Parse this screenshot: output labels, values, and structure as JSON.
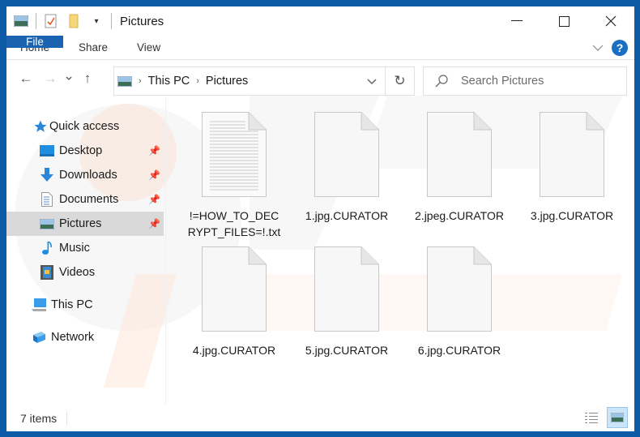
{
  "window": {
    "title": "Pictures",
    "controls": {
      "minimize": "—",
      "maximize": "☐",
      "close": "✕"
    }
  },
  "ribbon": {
    "tabs": [
      {
        "label": "File"
      },
      {
        "label": "Home"
      },
      {
        "label": "Share"
      },
      {
        "label": "View"
      }
    ],
    "help_label": "?"
  },
  "navigation": {
    "back": "←",
    "forward": "→",
    "recent": "⌄",
    "up": "↑",
    "breadcrumb": [
      "This PC",
      "Pictures"
    ],
    "refresh": "↻",
    "search_placeholder": "Search Pictures"
  },
  "sidebar": {
    "items": [
      {
        "label": "Quick access",
        "icon": "star-icon",
        "pinned": false
      },
      {
        "label": "Desktop",
        "icon": "desktop-icon",
        "pinned": true
      },
      {
        "label": "Downloads",
        "icon": "download-icon",
        "pinned": true
      },
      {
        "label": "Documents",
        "icon": "document-icon",
        "pinned": true
      },
      {
        "label": "Pictures",
        "icon": "pictures-icon",
        "pinned": true,
        "selected": true
      },
      {
        "label": "Music",
        "icon": "music-icon",
        "pinned": false
      },
      {
        "label": "Videos",
        "icon": "videos-icon",
        "pinned": false
      },
      {
        "label": "This PC",
        "icon": "computer-icon",
        "pinned": false
      },
      {
        "label": "Network",
        "icon": "network-icon",
        "pinned": false
      }
    ]
  },
  "files": [
    {
      "name": "!=HOW_TO_DECRYPT_FILES=!.txt",
      "name_line1": "!=HOW_TO_DEC",
      "name_line2": "RYPT_FILES=!.txt",
      "type": "text"
    },
    {
      "name": "1.jpg.CURATOR",
      "type": "blank"
    },
    {
      "name": "2.jpeg.CURATOR",
      "type": "blank"
    },
    {
      "name": "3.jpg.CURATOR",
      "type": "blank"
    },
    {
      "name": "4.jpg.CURATOR",
      "type": "blank"
    },
    {
      "name": "5.jpg.CURATOR",
      "type": "blank"
    },
    {
      "name": "6.jpg.CURATOR",
      "type": "blank"
    }
  ],
  "status": {
    "item_count": "7 items"
  },
  "colors": {
    "frame": "#0d5aa6",
    "file_tab": "#1a63b0",
    "selection": "#d9d9d9",
    "accent": "#1a6fc2"
  }
}
